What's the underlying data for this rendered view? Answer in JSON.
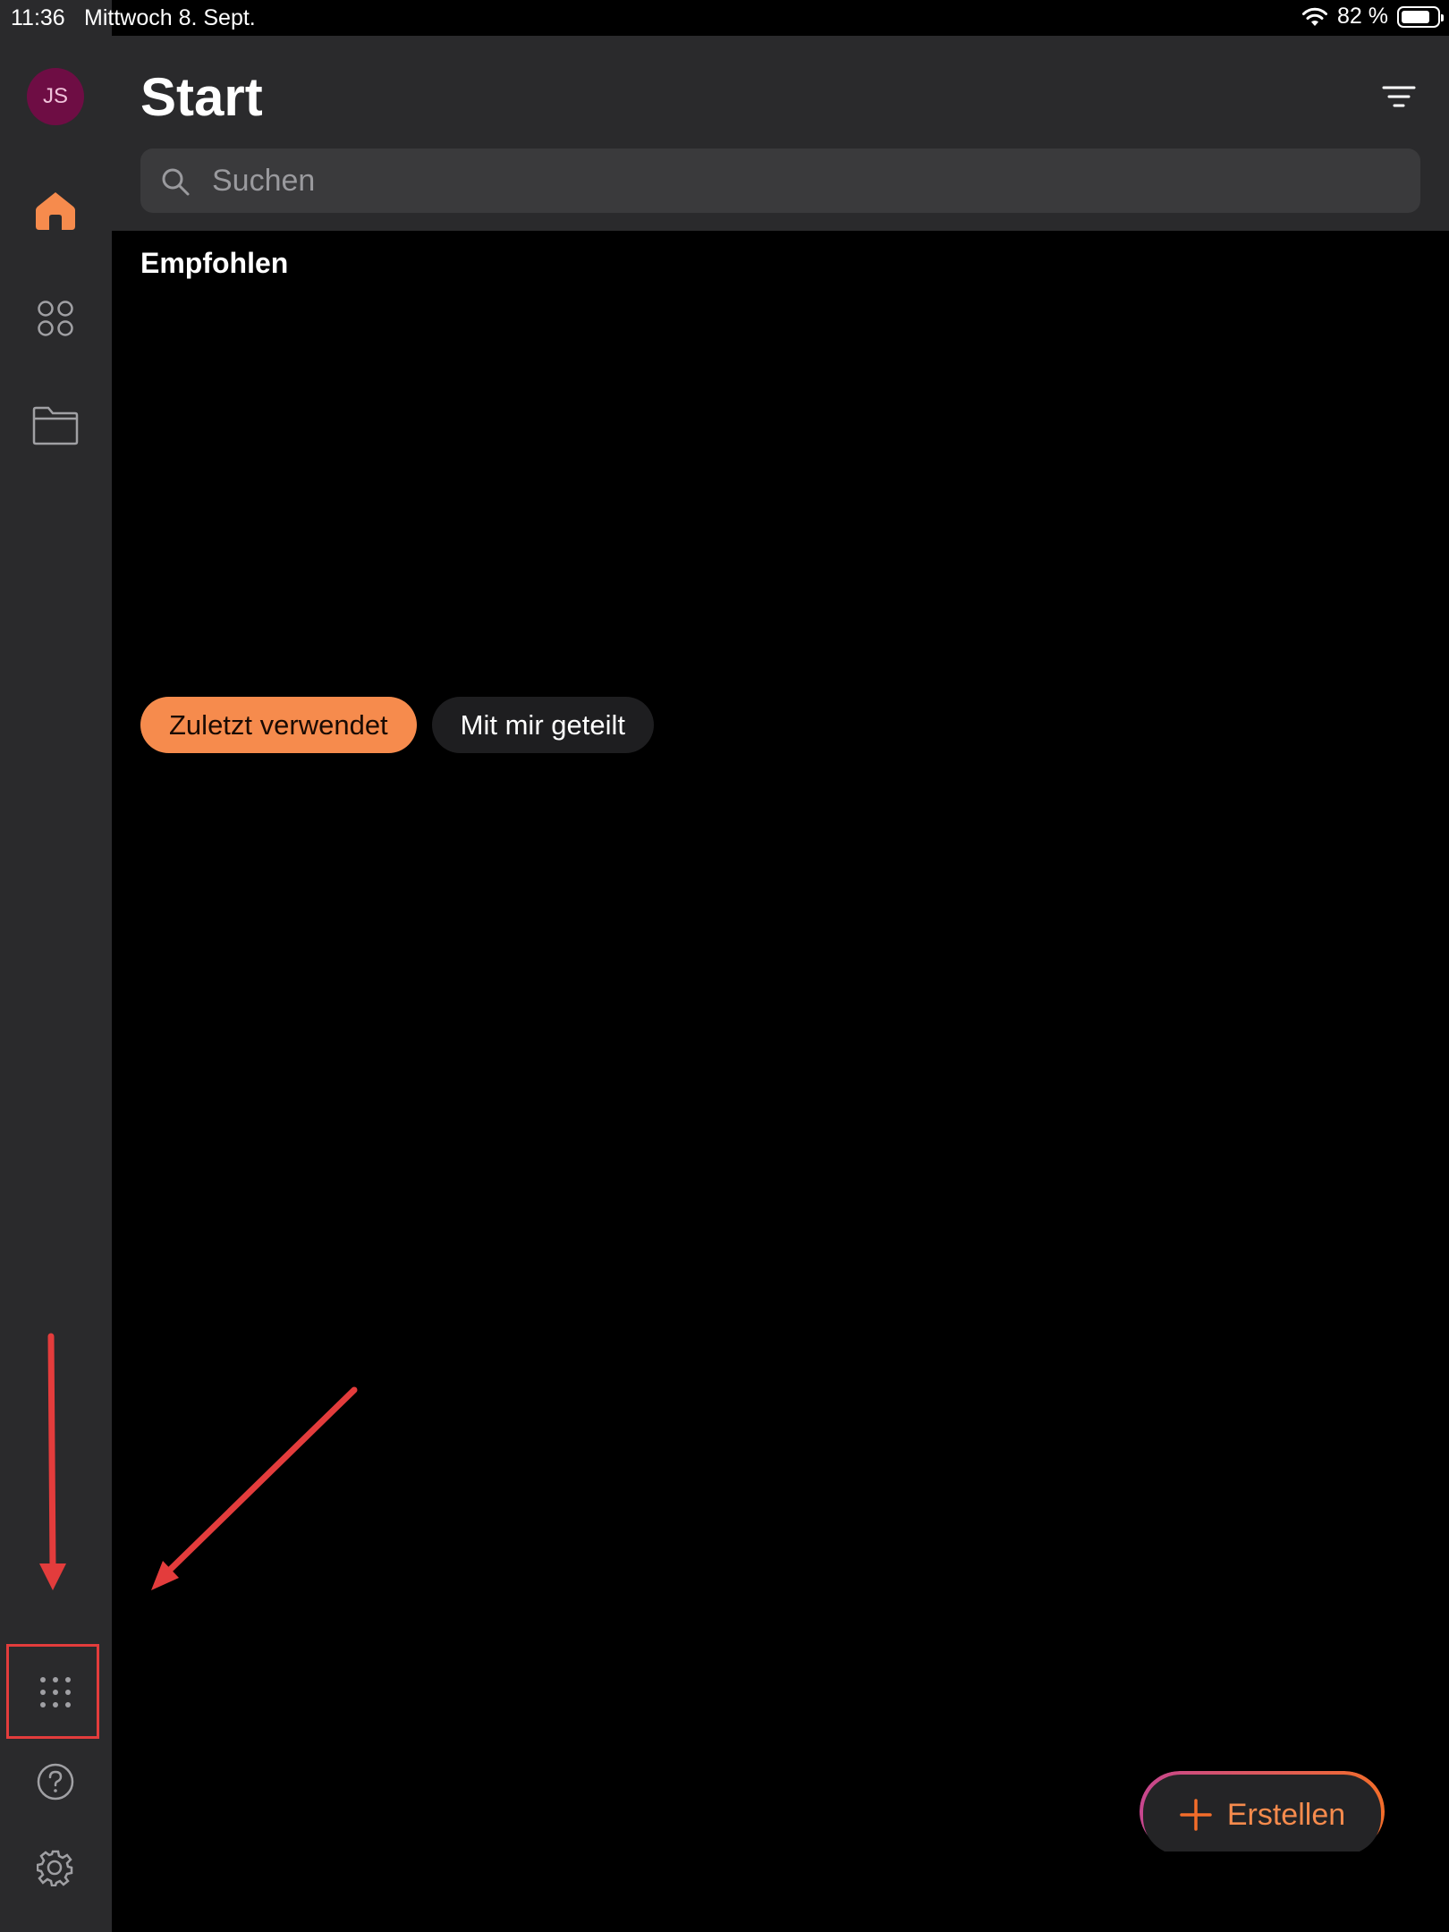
{
  "statusbar": {
    "time": "11:36",
    "date": "Mittwoch 8. Sept.",
    "battery_percent": "82 %",
    "battery_level": 0.82
  },
  "sidebar": {
    "avatar_initials": "JS",
    "avatar_color": "#6e0d44",
    "items": [
      {
        "name": "home",
        "icon": "home-icon",
        "active": true
      },
      {
        "name": "apps",
        "icon": "apps-grid-icon",
        "active": false
      },
      {
        "name": "files",
        "icon": "folder-icon",
        "active": false
      },
      {
        "name": "more-apps",
        "icon": "dots-grid-icon",
        "active": false
      },
      {
        "name": "help",
        "icon": "help-icon",
        "active": false
      },
      {
        "name": "settings",
        "icon": "gear-icon",
        "active": false
      }
    ]
  },
  "header": {
    "title": "Start",
    "filter_icon": "filter-icon"
  },
  "search": {
    "placeholder": "Suchen"
  },
  "main": {
    "section_title": "Empfohlen",
    "tabs": [
      {
        "label": "Zuletzt verwendet",
        "active": true
      },
      {
        "label": "Mit mir geteilt",
        "active": false
      }
    ]
  },
  "create_button": {
    "label": "Erstellen"
  },
  "colors": {
    "accent": "#f68b4d",
    "sidebar_bg": "#2a2a2c",
    "annotation_red": "#e33c3c"
  }
}
